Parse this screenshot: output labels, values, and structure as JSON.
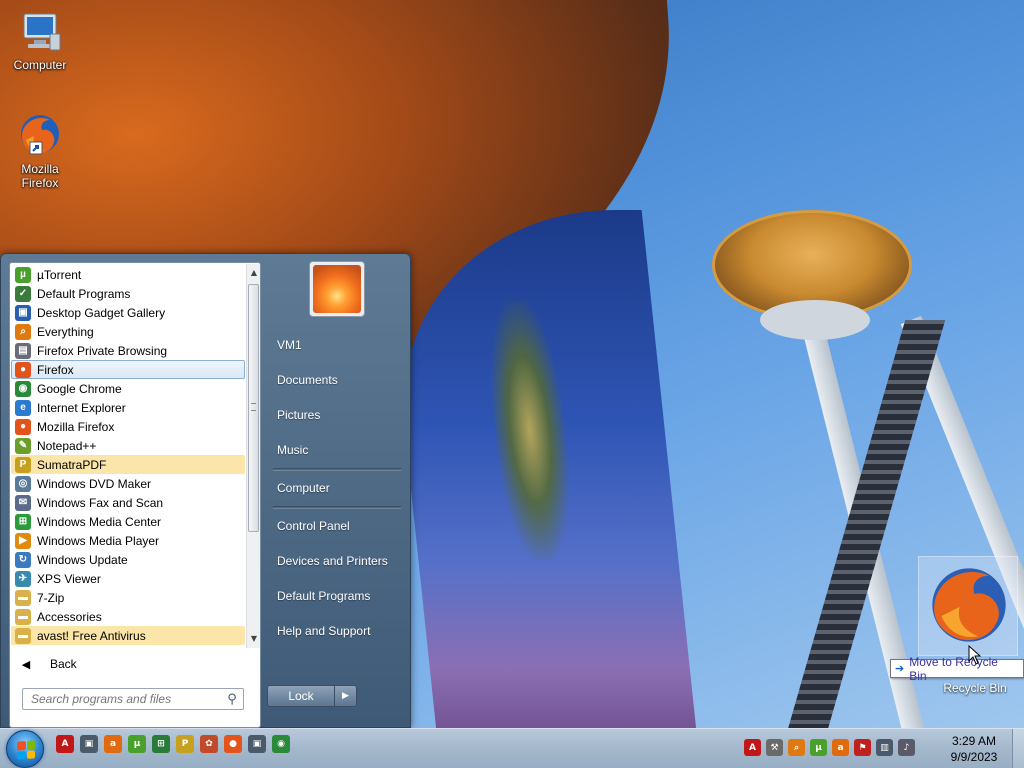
{
  "desktop": {
    "icons": [
      {
        "label": "Computer"
      },
      {
        "label": "Mozilla Firefox"
      }
    ],
    "drag": {
      "tooltip": "Move to Recycle Bin",
      "target_label": "Recycle Bin"
    }
  },
  "start_menu": {
    "programs": [
      {
        "label": "µTorrent",
        "icon": "utorrent-icon",
        "color": "#4aa02c",
        "glyph": "µ"
      },
      {
        "label": "Default Programs",
        "icon": "default-programs-icon",
        "color": "#3a7a3a",
        "glyph": "✓"
      },
      {
        "label": "Desktop Gadget Gallery",
        "icon": "gadget-gallery-icon",
        "color": "#2a5fb0",
        "glyph": "▣"
      },
      {
        "label": "Everything",
        "icon": "everything-search-icon",
        "color": "#e07a10",
        "glyph": "⌕"
      },
      {
        "label": "Firefox Private Browsing",
        "icon": "firefox-private-icon",
        "color": "#6a6a7a",
        "glyph": "▤"
      },
      {
        "label": "Firefox",
        "icon": "firefox-icon",
        "color": "#e3541c",
        "glyph": "●"
      },
      {
        "label": "Google Chrome",
        "icon": "chrome-icon",
        "color": "#2a8a3a",
        "glyph": "◉"
      },
      {
        "label": "Internet Explorer",
        "icon": "internet-explorer-icon",
        "color": "#2a7ad0",
        "glyph": "e"
      },
      {
        "label": "Mozilla Firefox",
        "icon": "firefox-icon",
        "color": "#e3541c",
        "glyph": "●"
      },
      {
        "label": "Notepad++",
        "icon": "notepadpp-icon",
        "color": "#6aa02a",
        "glyph": "✎"
      },
      {
        "label": "SumatraPDF",
        "icon": "sumatrapdf-icon",
        "color": "#c8a020",
        "glyph": "P"
      },
      {
        "label": "Windows DVD Maker",
        "icon": "dvd-maker-icon",
        "color": "#5a7a9a",
        "glyph": "◎"
      },
      {
        "label": "Windows Fax and Scan",
        "icon": "fax-scan-icon",
        "color": "#5a6a8a",
        "glyph": "✉"
      },
      {
        "label": "Windows Media Center",
        "icon": "media-center-icon",
        "color": "#2a9a3a",
        "glyph": "⊞"
      },
      {
        "label": "Windows Media Player",
        "icon": "media-player-icon",
        "color": "#e08a10",
        "glyph": "▶"
      },
      {
        "label": "Windows Update",
        "icon": "windows-update-icon",
        "color": "#3a7ac0",
        "glyph": "↻"
      },
      {
        "label": "XPS Viewer",
        "icon": "xps-viewer-icon",
        "color": "#3a8ab0",
        "glyph": "✈"
      },
      {
        "label": "7-Zip",
        "icon": "folder-icon",
        "color": "#d9b04a",
        "glyph": "▬"
      },
      {
        "label": "Accessories",
        "icon": "folder-icon",
        "color": "#d9b04a",
        "glyph": "▬"
      },
      {
        "label": "avast! Free Antivirus",
        "icon": "folder-icon",
        "color": "#d9b04a",
        "glyph": "▬"
      }
    ],
    "back_label": "Back",
    "search_placeholder": "Search programs and files",
    "right_items": [
      "VM1",
      "Documents",
      "Pictures",
      "Music",
      "Computer",
      "Control Panel",
      "Devices and Printers",
      "Default Programs",
      "Help and Support"
    ],
    "lock_label": "Lock"
  },
  "taskbar": {
    "pinned": [
      {
        "icon": "acrobat-icon",
        "color": "#c01818",
        "glyph": "A"
      },
      {
        "icon": "window-icon",
        "color": "#4a5a6a",
        "glyph": "▣"
      },
      {
        "icon": "avast-icon",
        "color": "#e06a10",
        "glyph": "a"
      },
      {
        "icon": "utorrent-icon",
        "color": "#4aa02c",
        "glyph": "µ"
      },
      {
        "icon": "media-center-icon",
        "color": "#2a7a3a",
        "glyph": "⊞"
      },
      {
        "icon": "sumatrapdf-icon",
        "color": "#c8a020",
        "glyph": "P"
      },
      {
        "icon": "paint-icon",
        "color": "#c04a2a",
        "glyph": "✿"
      },
      {
        "icon": "firefox-icon",
        "color": "#e3541c",
        "glyph": "●"
      },
      {
        "icon": "window-icon",
        "color": "#4a5a6a",
        "glyph": "▣"
      },
      {
        "icon": "chrome-icon",
        "color": "#2a8a3a",
        "glyph": "◉"
      }
    ],
    "tray": [
      {
        "icon": "acrobat-tray-icon",
        "color": "#c01818",
        "glyph": "A"
      },
      {
        "icon": "tools-tray-icon",
        "color": "#6a6a6a",
        "glyph": "⚒"
      },
      {
        "icon": "everything-tray-icon",
        "color": "#e07a10",
        "glyph": "⌕"
      },
      {
        "icon": "utorrent-tray-icon",
        "color": "#4aa02c",
        "glyph": "µ"
      },
      {
        "icon": "avast-tray-icon",
        "color": "#e06a10",
        "glyph": "a"
      },
      {
        "icon": "action-center-icon",
        "color": "#c02020",
        "glyph": "⚑"
      },
      {
        "icon": "network-icon",
        "color": "#4a5a6a",
        "glyph": "▥"
      },
      {
        "icon": "volume-muted-icon",
        "color": "#5a5a6a",
        "glyph": "♪"
      }
    ],
    "time": "3:29 AM",
    "date": "9/9/2023"
  }
}
